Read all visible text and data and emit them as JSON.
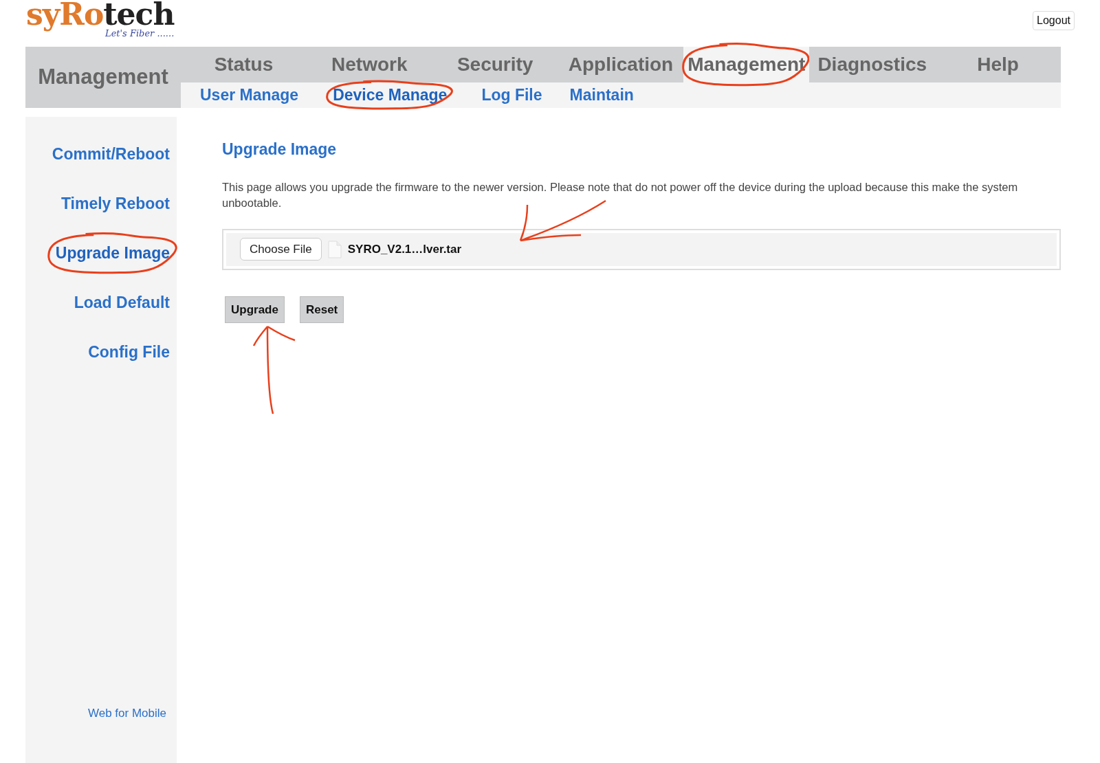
{
  "logo": {
    "brand_first": "syRo",
    "brand_second": "tech",
    "tagline": "Let's Fiber ......"
  },
  "logout": "Logout",
  "section_title": "Management",
  "top_tabs": [
    {
      "label": "Status",
      "selected": false,
      "circled": false
    },
    {
      "label": "Network",
      "selected": false,
      "circled": false
    },
    {
      "label": "Security",
      "selected": false,
      "circled": false
    },
    {
      "label": "Application",
      "selected": false,
      "circled": false
    },
    {
      "label": "Management",
      "selected": true,
      "circled": true
    },
    {
      "label": "Diagnostics",
      "selected": false,
      "circled": false
    },
    {
      "label": "Help",
      "selected": false,
      "circled": false
    }
  ],
  "sub_tabs": [
    {
      "label": "User Manage",
      "selected": false,
      "circled": false
    },
    {
      "label": "Device Manage",
      "selected": true,
      "circled": true
    },
    {
      "label": "Log File",
      "selected": false,
      "circled": false
    },
    {
      "label": "Maintain",
      "selected": false,
      "circled": false
    }
  ],
  "sidebar": {
    "items": [
      {
        "label": "Commit/Reboot",
        "selected": false,
        "circled": false
      },
      {
        "label": "Timely Reboot",
        "selected": false,
        "circled": false
      },
      {
        "label": "Upgrade Image",
        "selected": true,
        "circled": true
      },
      {
        "label": "Load Default",
        "selected": false,
        "circled": false
      },
      {
        "label": "Config File",
        "selected": false,
        "circled": false
      }
    ],
    "footer_link": "Web for Mobile"
  },
  "content": {
    "title": "Upgrade Image",
    "description": "This page allows you upgrade the firmware to the newer version. Please note that do not power off the device during the upload because this make the system unbootable.",
    "file_input": {
      "button": "Choose File",
      "file_name": "SYRO_V2.1…lver.tar",
      "arrow_marked": true
    },
    "buttons": [
      {
        "label": "Upgrade",
        "arrow_marked": true
      },
      {
        "label": "Reset",
        "arrow_marked": false
      }
    ]
  }
}
